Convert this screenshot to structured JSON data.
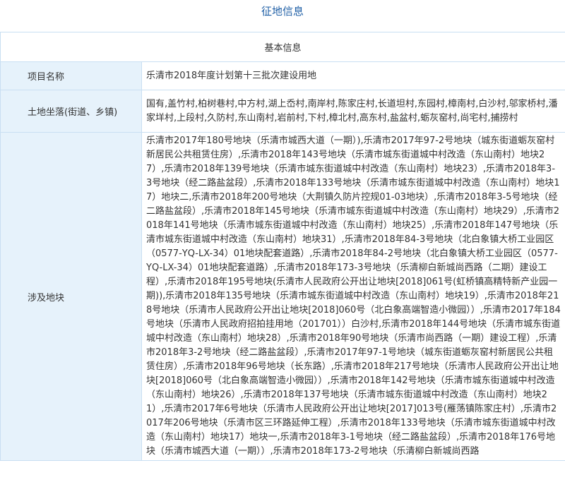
{
  "page": {
    "title": "征地信息"
  },
  "section": {
    "title": "基本信息"
  },
  "fields": {
    "project_name": {
      "label": "项目名称",
      "value": "乐清市2018年度计划第十三批次建设用地"
    },
    "land_location": {
      "label": "土地坐落(街道、乡镇)",
      "value": "国有,盖竹村,柏树巷村,中方村,湖上岙村,南岸村,陈家庄村,长道坦村,东园村,樟南村,白沙村,邬家桥村,潘家垟村,上段村,久防村,东山南村,岩前村,下村,樟北村,高东村,盐盆村,蛎灰窑村,尚宅村,捕捞村"
    },
    "plots": {
      "label": "涉及地块",
      "value": "乐清市2017年180号地块（乐清市城西大道（一期）),乐清市2017年97-2号地块（城东街道蛎灰窑村新居民公共租赁住房）,乐清市2018年143号地块（乐清市城东街道城中村改造（东山南村）地块27）,乐清市2018年139号地块（乐清市城东街道城中村改造（东山南村）地块23）,乐清市2018年3-3号地块（经二路盐盆段）,乐清市2018年133号地块（乐清市城东街道城中村改造（东山南村）地块17）地块二,乐清市2018年200号地块（大荆镇久防片控规01-03地块）,乐清市2018年3-5号地块（经二路盐盆段）,乐清市2018年145号地块（乐清市城东街道城中村改造（东山南村）地块29）,乐清市2018年141号地块（乐清市城东街道城中村改造（东山南村）地块25）,乐清市2018年147号地块（乐清市城东街道城中村改造（东山南村）地块31）,乐清市2018年84-3号地块（北白象镇大桥工业园区（0577-YQ-LX-34）01地块配套道路）,乐清市2018年84-2号地块（北白象镇大桥工业园区（0577-YQ-LX-34）01地块配套道路）,乐清市2018年173-3号地块（乐清柳白新城尚西路（二期）建设工程）,乐清市2018年195号地块(乐清市人民政府公开出让地块[2018]061号(虹桥镇高精特新产业园一期)),乐清市2018年135号地块（乐清市城东街道城中村改造（东山南村）地块19）,乐清市2018年218号地块（乐清市人民政府公开出让地块[2018]060号（北白象高端智造小微园））,乐清市2017年184号地块（乐清市人民政府招拍挂用地（201701））白沙村,乐清市2018年144号地块（乐清市城东街道城中村改造（东山南村）地块28）,乐清市2018年90号地块（乐清市尚西路（一期）建设工程）,乐清市2018年3-2号地块（经二路盐盆段）,乐清市2017年97-1号地块（城东街道蛎灰窑村新居民公共租赁住房）,乐清市2018年96号地块（长东路）,乐清市2018年217号地块（乐清市人民政府公开出让地块[2018]060号（北白象高端智造小微园））,乐清市2018年142号地块（乐清市城东街道城中村改造（东山南村）地块26）,乐清市2018年137号地块（乐清市城东街道城中村改造（东山南村）地块21）,乐清市2017年6号地块（乐清市人民政府公开出让地块[2017]013号(雁荡镇陈家庄村）,乐清市2017年206号地块（乐清市区三环路延伸工程）,乐清市2018年133号地块（乐清市城东街道城中村改造（东山南村）地块17）地块一,乐清市2018年3-1号地块（经二路盐盆段）,乐清市2018年176号地块（乐清市城西大道（一期））,乐清市2018年173-2号地块（乐清柳白新城尚西路"
    }
  }
}
